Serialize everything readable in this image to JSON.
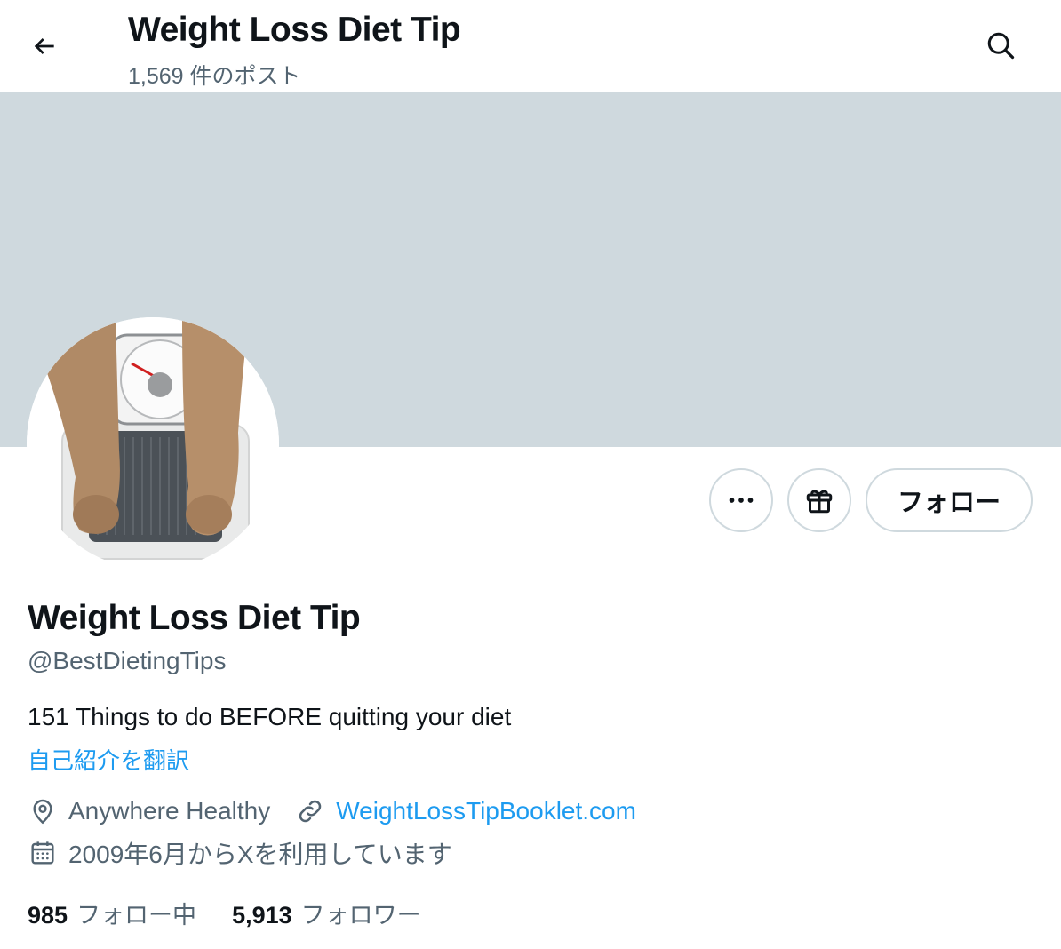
{
  "header": {
    "title": "Weight Loss Diet Tip",
    "post_count": "1,569 件のポスト",
    "back_icon": "arrow-left-icon",
    "search_icon": "search-icon"
  },
  "banner": {
    "color": "#cfd9de"
  },
  "profile": {
    "name": "Weight Loss Diet Tip",
    "handle": "@BestDietingTips",
    "bio": "151 Things to do BEFORE quitting your diet",
    "translate_label": "自己紹介を翻訳",
    "location": "Anywhere Healthy",
    "website": "WeightLossTipBooklet.com",
    "joined": "2009年6月からXを利用しています"
  },
  "actions": {
    "more_icon": "more-horizontal-icon",
    "gift_icon": "gift-icon",
    "follow_label": "フォロー"
  },
  "stats": {
    "following_count": "985",
    "following_label": "フォロー中",
    "followers_count": "5,913",
    "followers_label": "フォロワー"
  },
  "colors": {
    "accent": "#1d9bf0",
    "text_primary": "#0f1419",
    "text_secondary": "#536471",
    "border": "#cfd9de"
  }
}
